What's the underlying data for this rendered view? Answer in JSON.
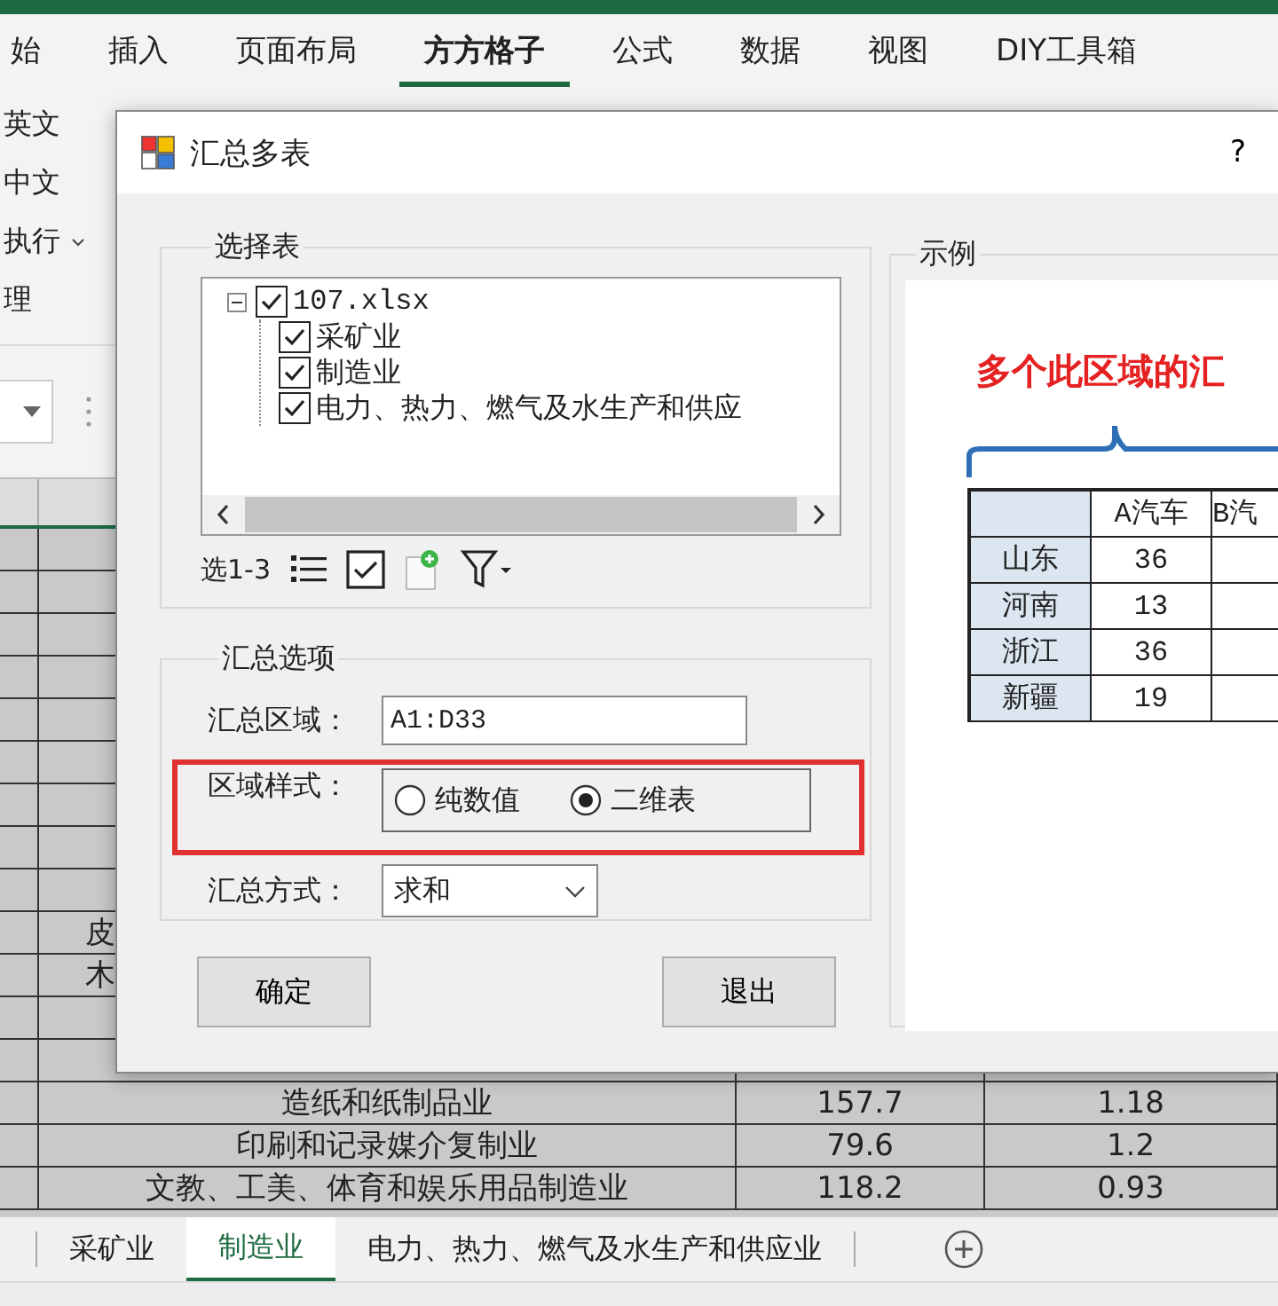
{
  "menu_tabs": [
    {
      "label": "始",
      "selected": false
    },
    {
      "label": "插入",
      "selected": false
    },
    {
      "label": "页面布局",
      "selected": false
    },
    {
      "label": "方方格子",
      "selected": true
    },
    {
      "label": "公式",
      "selected": false
    },
    {
      "label": "数据",
      "selected": false
    },
    {
      "label": "视图",
      "selected": false
    },
    {
      "label": "DIY工具箱",
      "selected": false
    }
  ],
  "ribbon_items": [
    {
      "label": "英文",
      "kind": "plain"
    },
    {
      "label": "中文",
      "kind": "plain"
    },
    {
      "label": "执行",
      "kind": "menu"
    },
    {
      "label": "理",
      "kind": "plain"
    }
  ],
  "sheet": {
    "rows": [
      {
        "kind": "partial",
        "name": "皮"
      },
      {
        "kind": "partial",
        "name": "木"
      },
      {
        "kind": "full",
        "name": "造纸和纸制品业",
        "value_1": "157.7",
        "value_2": "1.18"
      },
      {
        "kind": "full",
        "name": "印刷和记录媒介复制业",
        "value_1": "79.6",
        "value_2": "1.2"
      },
      {
        "kind": "full",
        "name": "文教、工美、体育和娱乐用品制造业",
        "value_1": "118.2",
        "value_2": "0.93"
      }
    ]
  },
  "sheet_tabs": [
    {
      "label": "采矿业",
      "selected": false
    },
    {
      "label": "制造业",
      "selected": true
    },
    {
      "label": "电力、热力、燃气及水生产和供应业",
      "selected": false
    }
  ],
  "dialog": {
    "title": "汇总多表",
    "help": "?",
    "select_group": {
      "title": "选择表",
      "tree": [
        {
          "label": "107.xlsx",
          "checked": true,
          "expanded": true,
          "children": [
            {
              "label": "采矿业",
              "checked": true
            },
            {
              "label": "制造业",
              "checked": true
            },
            {
              "label": "电力、热力、燃气及水生产和供应",
              "checked": true
            }
          ]
        }
      ],
      "range_label": "选1-3"
    },
    "options_group": {
      "title": "汇总选项",
      "fields": [
        {
          "kind": "input",
          "label": "汇总区域：",
          "value": "A1:D33",
          "highlighted": false
        },
        {
          "kind": "radio",
          "label": "区域样式：",
          "highlighted": true,
          "options": [
            {
              "label": "纯数值",
              "selected": false
            },
            {
              "label": "二维表",
              "selected": true
            }
          ]
        },
        {
          "kind": "select",
          "label": "汇总方式：",
          "value": "求和",
          "highlighted": false
        }
      ]
    },
    "example_group": {
      "title": "示例",
      "caption": "多个此区域的汇",
      "table": {
        "columns": [
          "A汽车",
          "B汽"
        ],
        "rows": [
          {
            "region": "山东",
            "value": "36"
          },
          {
            "region": "河南",
            "value": "13"
          },
          {
            "region": "浙江",
            "value": "36"
          },
          {
            "region": "新疆",
            "value": "19"
          }
        ]
      }
    },
    "buttons": [
      "确定",
      "退出"
    ]
  }
}
